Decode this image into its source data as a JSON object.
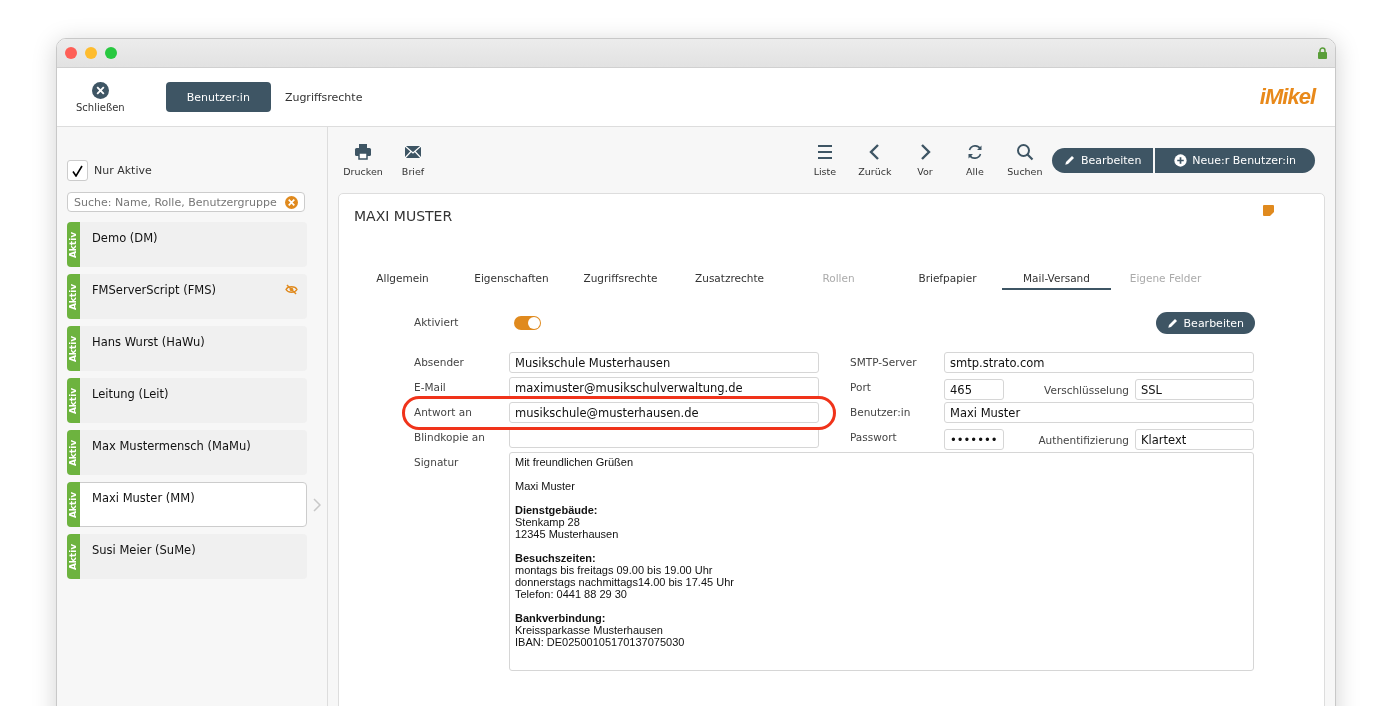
{
  "window": {
    "locked": true
  },
  "toolbar": {
    "close_label": "Schließen",
    "tabs": [
      {
        "label": "Benutzer:in",
        "selected": true
      },
      {
        "label": "Zugriffsrechte",
        "selected": false
      }
    ],
    "logo": "iMikel"
  },
  "sidebar": {
    "filter": {
      "label": "Nur Aktive",
      "checked": true
    },
    "search": {
      "placeholder": "Suche: Name, Rolle, Benutzergruppe"
    },
    "items": [
      {
        "name": "Demo (DM)",
        "status": "Aktiv",
        "selected": false,
        "hidden": false
      },
      {
        "name": "FMServerScript (FMS)",
        "status": "Aktiv",
        "selected": false,
        "hidden": true
      },
      {
        "name": "Hans Wurst (HaWu)",
        "status": "Aktiv",
        "selected": false,
        "hidden": false
      },
      {
        "name": "Leitung (Leit)",
        "status": "Aktiv",
        "selected": false,
        "hidden": false
      },
      {
        "name": "Max Mustermensch (MaMu)",
        "status": "Aktiv",
        "selected": false,
        "hidden": false
      },
      {
        "name": "Maxi Muster (MM)",
        "status": "Aktiv",
        "selected": true,
        "hidden": false
      },
      {
        "name": "Susi Meier (SuMe)",
        "status": "Aktiv",
        "selected": false,
        "hidden": false
      }
    ]
  },
  "actions": {
    "left": [
      {
        "kind": "print",
        "label": "Drucken"
      },
      {
        "kind": "mail",
        "label": "Brief"
      }
    ],
    "right": [
      {
        "kind": "list",
        "label": "Liste"
      },
      {
        "kind": "back",
        "label": "Zurück"
      },
      {
        "kind": "forward",
        "label": "Vor"
      },
      {
        "kind": "refresh",
        "label": "Alle"
      },
      {
        "kind": "search",
        "label": "Suchen"
      }
    ],
    "buttons": [
      {
        "kind": "edit",
        "label": "Bearbeiten"
      },
      {
        "kind": "add",
        "label": "Neue:r Benutzer:in"
      }
    ]
  },
  "record": {
    "title": "MAXI MUSTER",
    "note": true,
    "tabs": [
      {
        "label": "Allgemein",
        "selected": false,
        "disabled": false
      },
      {
        "label": "Eigenschaften",
        "selected": false,
        "disabled": false
      },
      {
        "label": "Zugriffsrechte",
        "selected": false,
        "disabled": false
      },
      {
        "label": "Zusatzrechte",
        "selected": false,
        "disabled": false
      },
      {
        "label": "Rollen",
        "selected": false,
        "disabled": true
      },
      {
        "label": "Briefpapier",
        "selected": false,
        "disabled": false
      },
      {
        "label": "Mail-Versand",
        "selected": true,
        "disabled": false
      },
      {
        "label": "Eigene Felder",
        "selected": false,
        "disabled": true
      }
    ],
    "enabled": {
      "label": "Aktiviert",
      "on": true
    },
    "edit_button": "Bearbeiten",
    "left_fields": [
      {
        "label": "Absender",
        "value": "Musikschule Musterhausen",
        "highlighted": false
      },
      {
        "label": "E-Mail",
        "value": "maximuster@musikschulverwaltung.de",
        "highlighted": false
      },
      {
        "label": "Antwort an",
        "value": "musikschule@musterhausen.de",
        "highlighted": true
      },
      {
        "label": "Blindkopie an",
        "highlighted": false
      }
    ],
    "right_fields": [
      {
        "label": "SMTP-Server",
        "value": "smtp.strato.com"
      },
      {
        "label": "Port",
        "value": "465",
        "second": {
          "label": "Verschlüsselung",
          "value": "SSL"
        }
      },
      {
        "label": "Benutzer:in",
        "value": "Maxi Muster"
      },
      {
        "label": "Passwort",
        "value": "•••••••",
        "second": {
          "label": "Authentifizierung",
          "value": "Klartext"
        }
      }
    ],
    "signature": {
      "label": "Signatur",
      "paragraphs": [
        {
          "lines": [
            "Mit freundlichen Grüßen"
          ]
        },
        {
          "lines": [
            "Maxi Muster"
          ]
        },
        {
          "heading": "Dienstgebäude:",
          "lines": [
            "Stenkamp 28",
            "12345 Musterhausen"
          ]
        },
        {
          "heading": "Besuchszeiten:",
          "lines": [
            "montags bis freitags 09.00 bis 19.00 Uhr",
            "donnerstags nachmittags14.00 bis 17.45 Uhr",
            "Telefon: 0441 88 29 30"
          ]
        },
        {
          "heading": "Bankverbindung:",
          "lines": [
            "Kreissparkasse Musterhausen",
            "IBAN:  DE02500105170137075030"
          ]
        }
      ]
    }
  }
}
